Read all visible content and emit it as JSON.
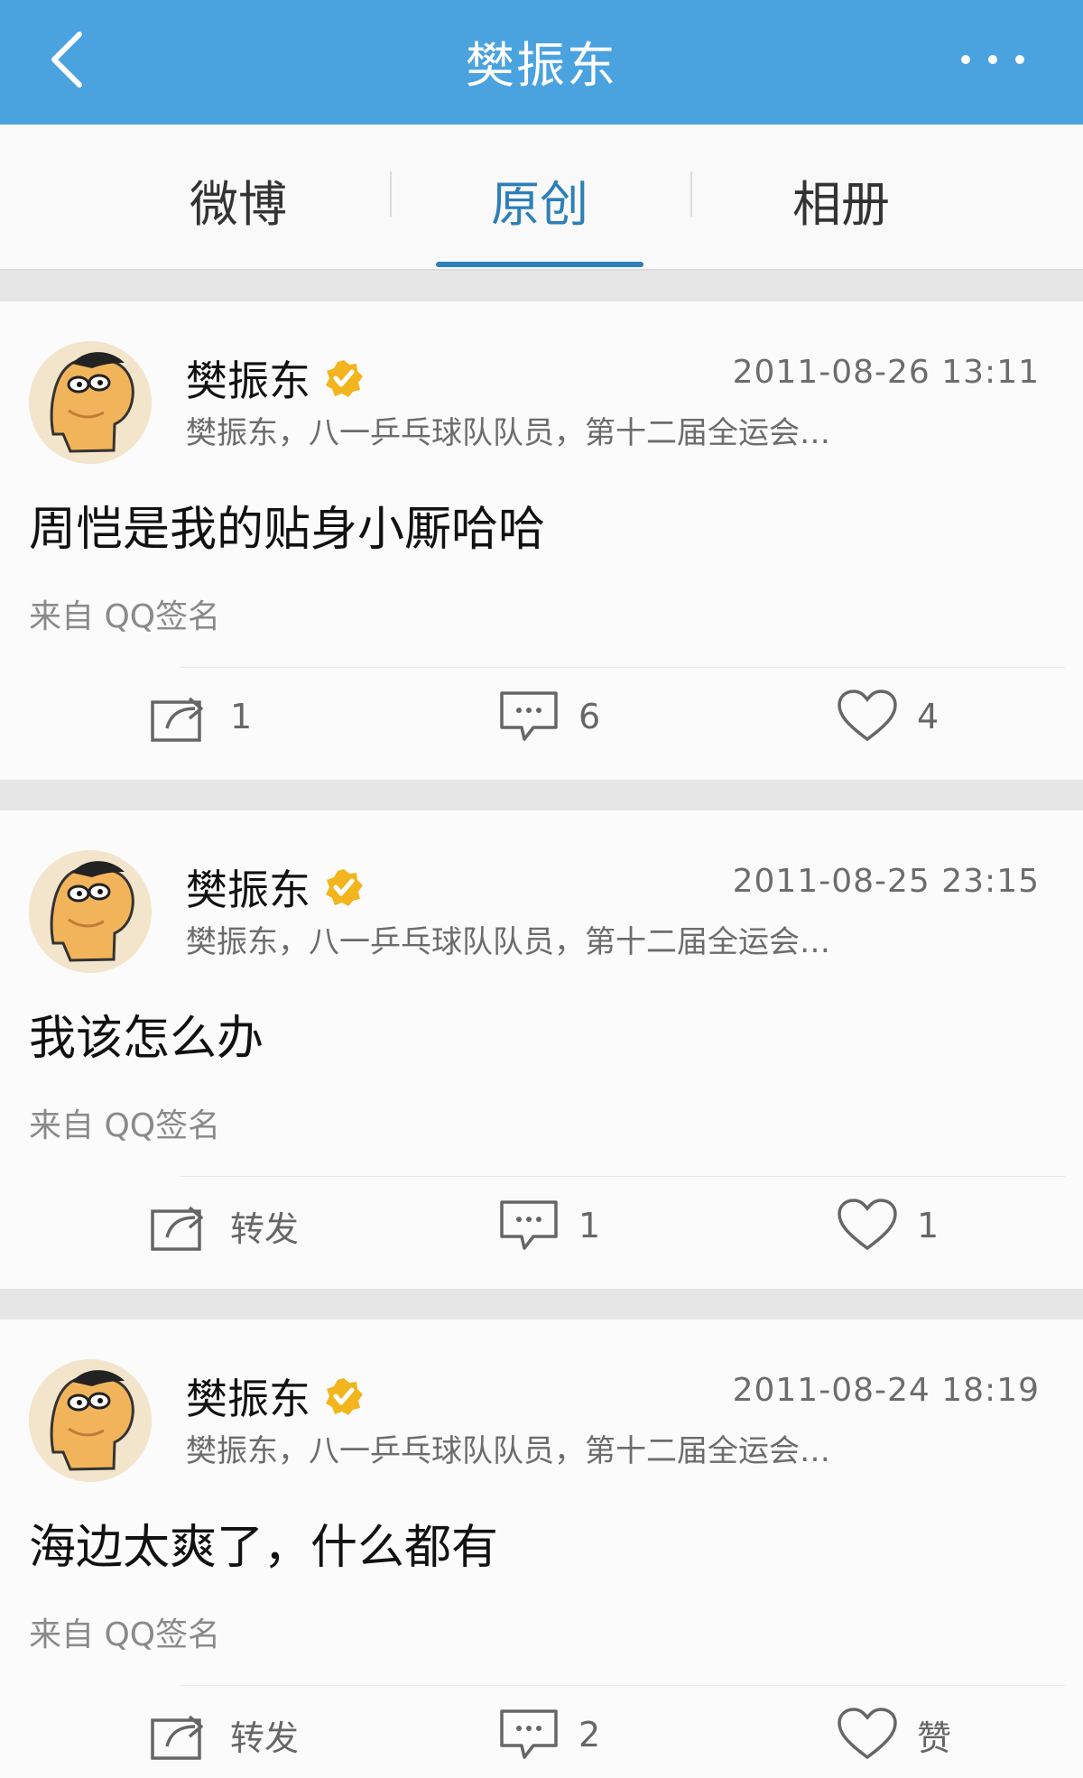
{
  "header": {
    "title": "樊振东",
    "back_icon": "chevron-left-icon",
    "more_icon": "more-dots-icon"
  },
  "tabs": [
    {
      "label": "微博",
      "active": false
    },
    {
      "label": "原创",
      "active": true
    },
    {
      "label": "相册",
      "active": false
    }
  ],
  "posts": [
    {
      "author": "樊振东",
      "time": "2011-08-26 13:11",
      "bio": "樊振东，八一乒乓球队队员，第十二届全运会…",
      "text": "周恺是我的贴身小厮哈哈",
      "source": "来自 QQ签名",
      "repost": "1",
      "comment": "6",
      "like": "4"
    },
    {
      "author": "樊振东",
      "time": "2011-08-25 23:15",
      "bio": "樊振东，八一乒乓球队队员，第十二届全运会…",
      "text": "我该怎么办",
      "source": "来自 QQ签名",
      "repost": "转发",
      "comment": "1",
      "like": "1"
    },
    {
      "author": "樊振东",
      "time": "2011-08-24 18:19",
      "bio": "樊振东，八一乒乓球队队员，第十二届全运会…",
      "text": "海边太爽了，什么都有",
      "source": "来自 QQ签名",
      "repost": "转发",
      "comment": "2",
      "like": "赞"
    }
  ],
  "colors": {
    "header_bg": "#4aa3df",
    "active_tab": "#2d7fb7",
    "verified_badge": "#f2b51d"
  }
}
